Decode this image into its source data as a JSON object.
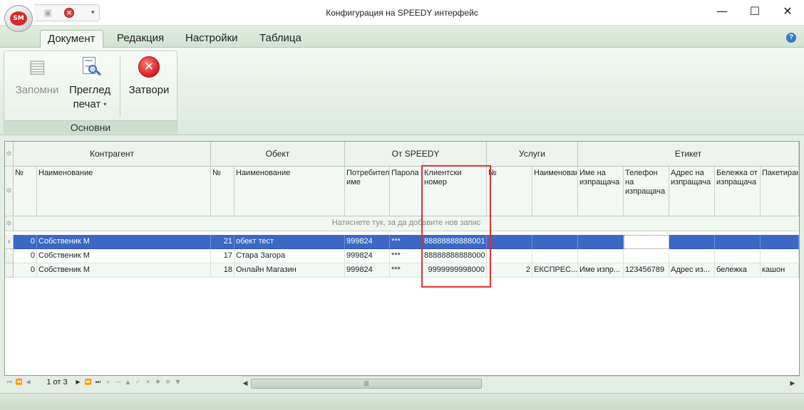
{
  "window": {
    "title": "Конфигурация на SPEEDY интерфейс",
    "logo_text": "SM",
    "minimize": "—",
    "maximize": "☐",
    "close": "✕"
  },
  "qat": {
    "save_icon": "save-icon",
    "close_icon": "close-icon",
    "more": "▾"
  },
  "tabs": [
    {
      "label": "Документ",
      "active": true
    },
    {
      "label": "Редакция"
    },
    {
      "label": "Настройки"
    },
    {
      "label": "Таблица"
    }
  ],
  "help": "?",
  "ribbon": {
    "group_label": "Основни",
    "save": {
      "label": "Запомни",
      "enabled": false
    },
    "preview": {
      "line1": "Преглед",
      "line2": "печат",
      "arrow": "▾"
    },
    "close": {
      "label": "Затвори",
      "glyph": "✕"
    }
  },
  "grid": {
    "bands": {
      "kontragent": "Контрагент",
      "obekt": "Обект",
      "ot_speedy": "От SPEEDY",
      "uslugi": "Услуги",
      "etiket": "Етикет"
    },
    "columns": {
      "k_no": "№",
      "k_name": "Наименование",
      "o_no": "№",
      "o_name": "Наименование",
      "user": "Потребителско име",
      "pass": "Парола",
      "client": "Клиентски номер",
      "u_no": "№",
      "u_name": "Наименование",
      "sender_name": "Име на изпращача",
      "sender_phone": "Телефон на изпращача",
      "sender_addr": "Адрес на изпращача",
      "sender_note": "Бележка от изпращача",
      "packing": "Пакетиране"
    },
    "new_row_text": "Натиснете тук, за да добавите нов запис",
    "rows": [
      {
        "k_no": "0",
        "k_name": "Собственик М",
        "o_no": "21",
        "o_name": "обект тест",
        "user": "999824",
        "pass": "***",
        "client": "88888888888001",
        "u_no": "",
        "u_name": "",
        "sender_name": "",
        "sender_phone": "",
        "sender_addr": "",
        "sender_note": "",
        "packing": ""
      },
      {
        "k_no": "0",
        "k_name": "Собственик М",
        "o_no": "17",
        "o_name": "Стара Загора",
        "user": "999824",
        "pass": "***",
        "client": "88888888888000",
        "u_no": "",
        "u_name": "",
        "sender_name": "",
        "sender_phone": "",
        "sender_addr": "",
        "sender_note": "",
        "packing": ""
      },
      {
        "k_no": "0",
        "k_name": "Собственик М",
        "o_no": "18",
        "o_name": "Онлайн Магазин",
        "user": "999824",
        "pass": "***",
        "client": "9999999998000",
        "u_no": "2",
        "u_name": "ЕКСПРЕС...",
        "sender_name": "Име изпр...",
        "sender_phone": "123456789",
        "sender_addr": "Адрес из...",
        "sender_note": "бележка",
        "packing": "кашон"
      }
    ]
  },
  "navigator": {
    "page_text": "1 от 3"
  },
  "colors": {
    "selection": "#3b67c6",
    "highlight_border": "#e32d2d",
    "theme_green": "#dde9dd"
  }
}
